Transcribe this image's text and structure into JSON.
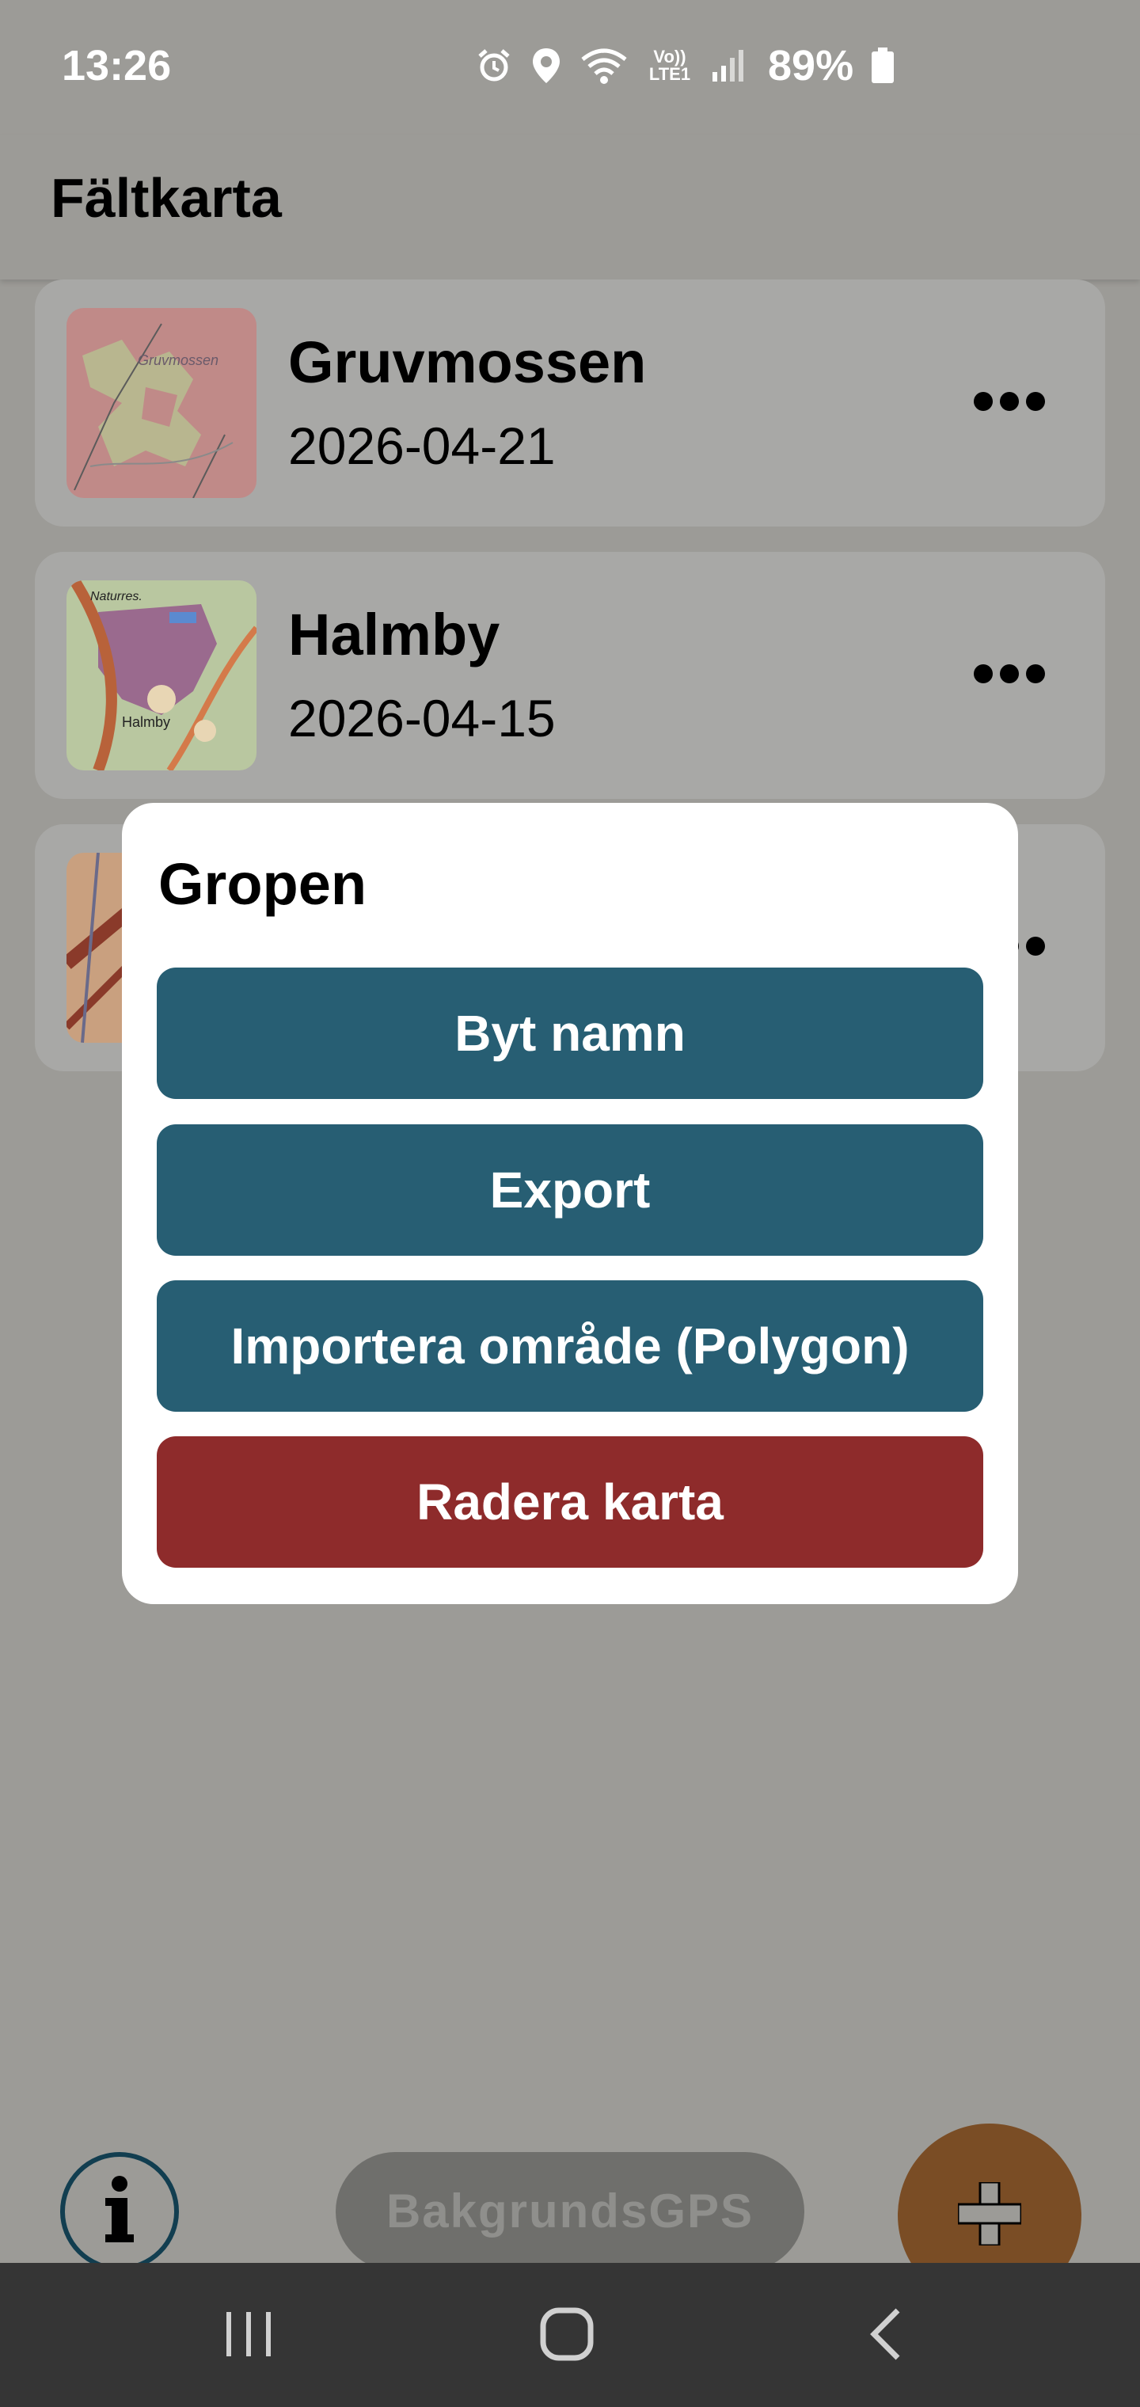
{
  "status_bar": {
    "time": "13:26",
    "icons": [
      "alarm-icon",
      "location-icon",
      "wifi-icon",
      "volte-icon",
      "signal-icon",
      "battery-icon"
    ],
    "volte_text": "Vo)) LTE1",
    "battery": "89%"
  },
  "app": {
    "title": "Fältkarta"
  },
  "maps": [
    {
      "name": "Gruvmossen",
      "date": "2026-04-21",
      "thumb_text": "Gruvmossen"
    },
    {
      "name": "Halmby",
      "date": "2026-04-15",
      "thumb_text": "Halmby",
      "thumb_text2": "Naturres."
    },
    {
      "name": "Gropen",
      "date": ""
    }
  ],
  "dialog": {
    "title": "Gropen",
    "buttons": {
      "rename": "Byt namn",
      "export": "Export",
      "import": "Importera område (Polygon)",
      "delete": "Radera karta"
    }
  },
  "bottom": {
    "gps_label": "BakgrundsGPS"
  },
  "colors": {
    "scrim": "#9c9b97",
    "teal_button": "#275e73",
    "delete_button": "#8e2b2b",
    "fab": "#7a4d25",
    "navbar": "#353535"
  }
}
